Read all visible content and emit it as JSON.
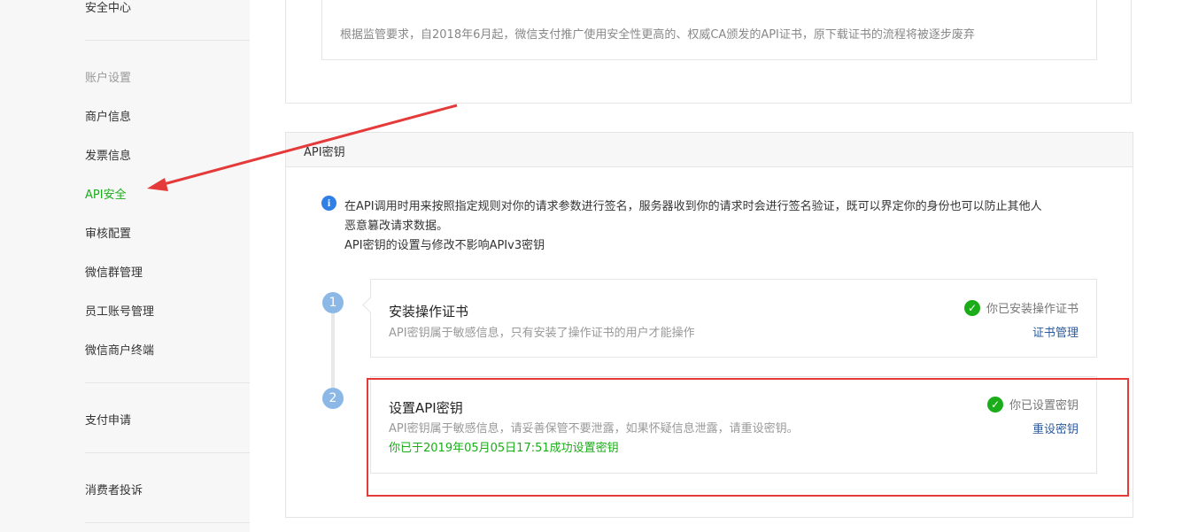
{
  "sidebar": {
    "security_center": "安全中心",
    "group_account": "账户设置",
    "items": [
      {
        "label": "商户信息"
      },
      {
        "label": "发票信息"
      },
      {
        "label": "API安全"
      },
      {
        "label": "审核配置"
      },
      {
        "label": "微信群管理"
      },
      {
        "label": "员工账号管理"
      },
      {
        "label": "微信商户终端"
      }
    ],
    "pay_apply": "支付申请",
    "consumer_complaint": "消费者投诉"
  },
  "notice": {
    "text": "根据监管要求，自2018年6月起，微信支付推广使用安全性更高的、权威CA颁发的API证书，原下载证书的流程将被逐步废弃"
  },
  "api_key": {
    "title": "API密钥",
    "info_line1": "在API调用时用来按照指定规则对你的请求参数进行签名，服务器收到你的请求时会进行签名验证，既可以界定你的身份也可以防止其他人",
    "info_line2": "恶意篡改请求数据。",
    "info_line3": "API密钥的设置与修改不影响APIv3密钥",
    "steps": [
      {
        "number": "1",
        "title": "安装操作证书",
        "desc": "API密钥属于敏感信息，只有安装了操作证书的用户才能操作",
        "status": "你已安装操作证书",
        "action": "证书管理"
      },
      {
        "number": "2",
        "title": "设置API密钥",
        "desc": "API密钥属于敏感信息，请妥善保管不要泄露，如果怀疑信息泄露，请重设密钥。",
        "success": "你已于2019年05月05日17:51成功设置密钥",
        "status": "你已设置密钥",
        "action": "重设密钥"
      }
    ]
  },
  "colors": {
    "accent_green": "#1aad19",
    "link_blue": "#2c5a9c",
    "annotation_red": "#e53a3a"
  }
}
